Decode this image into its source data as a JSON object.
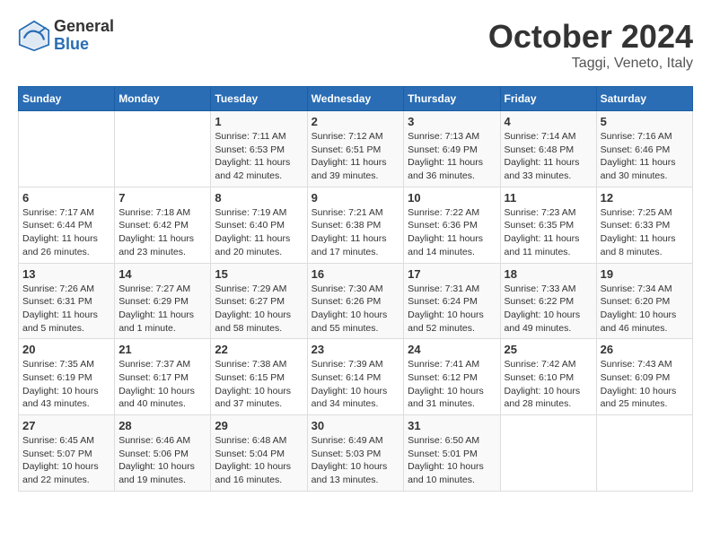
{
  "header": {
    "logo_general": "General",
    "logo_blue": "Blue",
    "month_title": "October 2024",
    "location": "Taggi, Veneto, Italy"
  },
  "weekdays": [
    "Sunday",
    "Monday",
    "Tuesday",
    "Wednesday",
    "Thursday",
    "Friday",
    "Saturday"
  ],
  "weeks": [
    [
      {
        "day": "",
        "sunrise": "",
        "sunset": "",
        "daylight": ""
      },
      {
        "day": "",
        "sunrise": "",
        "sunset": "",
        "daylight": ""
      },
      {
        "day": "1",
        "sunrise": "Sunrise: 7:11 AM",
        "sunset": "Sunset: 6:53 PM",
        "daylight": "Daylight: 11 hours and 42 minutes."
      },
      {
        "day": "2",
        "sunrise": "Sunrise: 7:12 AM",
        "sunset": "Sunset: 6:51 PM",
        "daylight": "Daylight: 11 hours and 39 minutes."
      },
      {
        "day": "3",
        "sunrise": "Sunrise: 7:13 AM",
        "sunset": "Sunset: 6:49 PM",
        "daylight": "Daylight: 11 hours and 36 minutes."
      },
      {
        "day": "4",
        "sunrise": "Sunrise: 7:14 AM",
        "sunset": "Sunset: 6:48 PM",
        "daylight": "Daylight: 11 hours and 33 minutes."
      },
      {
        "day": "5",
        "sunrise": "Sunrise: 7:16 AM",
        "sunset": "Sunset: 6:46 PM",
        "daylight": "Daylight: 11 hours and 30 minutes."
      }
    ],
    [
      {
        "day": "6",
        "sunrise": "Sunrise: 7:17 AM",
        "sunset": "Sunset: 6:44 PM",
        "daylight": "Daylight: 11 hours and 26 minutes."
      },
      {
        "day": "7",
        "sunrise": "Sunrise: 7:18 AM",
        "sunset": "Sunset: 6:42 PM",
        "daylight": "Daylight: 11 hours and 23 minutes."
      },
      {
        "day": "8",
        "sunrise": "Sunrise: 7:19 AM",
        "sunset": "Sunset: 6:40 PM",
        "daylight": "Daylight: 11 hours and 20 minutes."
      },
      {
        "day": "9",
        "sunrise": "Sunrise: 7:21 AM",
        "sunset": "Sunset: 6:38 PM",
        "daylight": "Daylight: 11 hours and 17 minutes."
      },
      {
        "day": "10",
        "sunrise": "Sunrise: 7:22 AM",
        "sunset": "Sunset: 6:36 PM",
        "daylight": "Daylight: 11 hours and 14 minutes."
      },
      {
        "day": "11",
        "sunrise": "Sunrise: 7:23 AM",
        "sunset": "Sunset: 6:35 PM",
        "daylight": "Daylight: 11 hours and 11 minutes."
      },
      {
        "day": "12",
        "sunrise": "Sunrise: 7:25 AM",
        "sunset": "Sunset: 6:33 PM",
        "daylight": "Daylight: 11 hours and 8 minutes."
      }
    ],
    [
      {
        "day": "13",
        "sunrise": "Sunrise: 7:26 AM",
        "sunset": "Sunset: 6:31 PM",
        "daylight": "Daylight: 11 hours and 5 minutes."
      },
      {
        "day": "14",
        "sunrise": "Sunrise: 7:27 AM",
        "sunset": "Sunset: 6:29 PM",
        "daylight": "Daylight: 11 hours and 1 minute."
      },
      {
        "day": "15",
        "sunrise": "Sunrise: 7:29 AM",
        "sunset": "Sunset: 6:27 PM",
        "daylight": "Daylight: 10 hours and 58 minutes."
      },
      {
        "day": "16",
        "sunrise": "Sunrise: 7:30 AM",
        "sunset": "Sunset: 6:26 PM",
        "daylight": "Daylight: 10 hours and 55 minutes."
      },
      {
        "day": "17",
        "sunrise": "Sunrise: 7:31 AM",
        "sunset": "Sunset: 6:24 PM",
        "daylight": "Daylight: 10 hours and 52 minutes."
      },
      {
        "day": "18",
        "sunrise": "Sunrise: 7:33 AM",
        "sunset": "Sunset: 6:22 PM",
        "daylight": "Daylight: 10 hours and 49 minutes."
      },
      {
        "day": "19",
        "sunrise": "Sunrise: 7:34 AM",
        "sunset": "Sunset: 6:20 PM",
        "daylight": "Daylight: 10 hours and 46 minutes."
      }
    ],
    [
      {
        "day": "20",
        "sunrise": "Sunrise: 7:35 AM",
        "sunset": "Sunset: 6:19 PM",
        "daylight": "Daylight: 10 hours and 43 minutes."
      },
      {
        "day": "21",
        "sunrise": "Sunrise: 7:37 AM",
        "sunset": "Sunset: 6:17 PM",
        "daylight": "Daylight: 10 hours and 40 minutes."
      },
      {
        "day": "22",
        "sunrise": "Sunrise: 7:38 AM",
        "sunset": "Sunset: 6:15 PM",
        "daylight": "Daylight: 10 hours and 37 minutes."
      },
      {
        "day": "23",
        "sunrise": "Sunrise: 7:39 AM",
        "sunset": "Sunset: 6:14 PM",
        "daylight": "Daylight: 10 hours and 34 minutes."
      },
      {
        "day": "24",
        "sunrise": "Sunrise: 7:41 AM",
        "sunset": "Sunset: 6:12 PM",
        "daylight": "Daylight: 10 hours and 31 minutes."
      },
      {
        "day": "25",
        "sunrise": "Sunrise: 7:42 AM",
        "sunset": "Sunset: 6:10 PM",
        "daylight": "Daylight: 10 hours and 28 minutes."
      },
      {
        "day": "26",
        "sunrise": "Sunrise: 7:43 AM",
        "sunset": "Sunset: 6:09 PM",
        "daylight": "Daylight: 10 hours and 25 minutes."
      }
    ],
    [
      {
        "day": "27",
        "sunrise": "Sunrise: 6:45 AM",
        "sunset": "Sunset: 5:07 PM",
        "daylight": "Daylight: 10 hours and 22 minutes."
      },
      {
        "day": "28",
        "sunrise": "Sunrise: 6:46 AM",
        "sunset": "Sunset: 5:06 PM",
        "daylight": "Daylight: 10 hours and 19 minutes."
      },
      {
        "day": "29",
        "sunrise": "Sunrise: 6:48 AM",
        "sunset": "Sunset: 5:04 PM",
        "daylight": "Daylight: 10 hours and 16 minutes."
      },
      {
        "day": "30",
        "sunrise": "Sunrise: 6:49 AM",
        "sunset": "Sunset: 5:03 PM",
        "daylight": "Daylight: 10 hours and 13 minutes."
      },
      {
        "day": "31",
        "sunrise": "Sunrise: 6:50 AM",
        "sunset": "Sunset: 5:01 PM",
        "daylight": "Daylight: 10 hours and 10 minutes."
      },
      {
        "day": "",
        "sunrise": "",
        "sunset": "",
        "daylight": ""
      },
      {
        "day": "",
        "sunrise": "",
        "sunset": "",
        "daylight": ""
      }
    ]
  ]
}
